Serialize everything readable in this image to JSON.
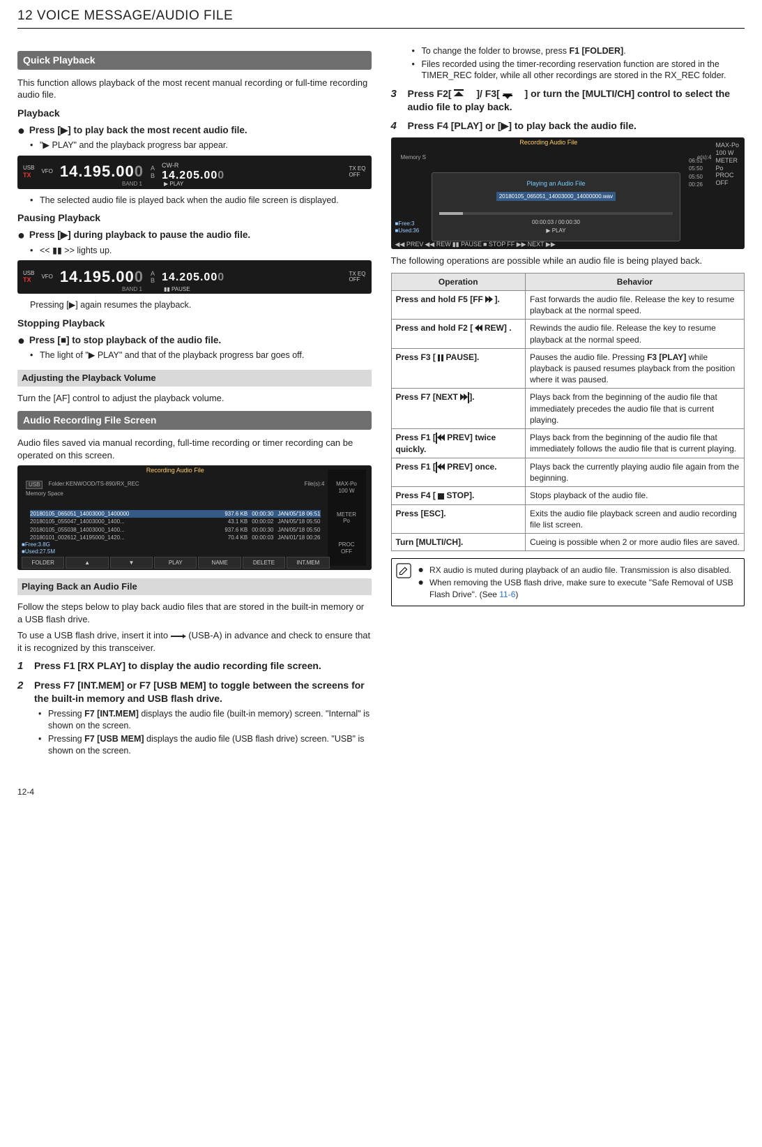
{
  "chapter": "12 VOICE MESSAGE/AUDIO FILE",
  "pageNumber": "12-4",
  "left": {
    "quickPlayback": {
      "title": "Quick Playback",
      "intro": "This function allows playback of the most recent manual recording or full-time recording audio file.",
      "playbackHeading": "Playback",
      "play_instruction": "Press [▶] to play back the most recent audio file.",
      "play_note": "\"▶ PLAY\" and the playback progress bar appear.",
      "play_note2": "The selected audio file is played back when the audio file screen is displayed.",
      "pausingHeading": "Pausing Playback",
      "pause_instruction": "Press [▶] during playback to pause the audio file.",
      "pause_note": "<< ▮▮ >> lights up.",
      "pause_resume": "Pressing [▶] again resumes the playback.",
      "stoppingHeading": "Stopping Playback",
      "stop_instruction": "Press [■] to stop playback of the audio file.",
      "stop_note": "The light of \"▶ PLAY\" and that of the playback progress bar goes off.",
      "volumeTitle": "Adjusting the Playback Volume",
      "volumeText": "Turn the [AF] control to adjust the playback volume."
    },
    "screenSmall1": {
      "usb": "USB",
      "vfo": "VFO",
      "tx": "TX",
      "freqA": "14.195.00",
      "freqA_dim": "0",
      "ab": "A▸\nB",
      "mode": "CW-R",
      "freqB": "14.205.00",
      "freqB_dim": "0",
      "band": "BAND 1",
      "play": "▶ PLAY",
      "right1": "OFF",
      "right2": "TX EQ\nOFF"
    },
    "screenSmall2": {
      "usb": "USB",
      "vfo": "VFO",
      "tx": "TX",
      "freqA": "14.195.00",
      "freqA_dim": "0",
      "freqB": "14.205.00",
      "freqB_dim": "0",
      "band": "BAND 1",
      "play": "▮▮ PAUSE",
      "right2": "TX EQ\nOFF"
    },
    "audioRecScreen": {
      "title": "Audio Recording File Screen",
      "intro": "Audio files saved via manual recording, full-time recording or timer recording can be operated on this screen."
    },
    "screenLarge": {
      "titlebar": "Recording Audio File",
      "memUSB": "USB",
      "folder": "Folder:KENWOOD/TS-890/RX_REC",
      "files": "File(s):4",
      "rows": [
        {
          "name": "20180105_065051_14003000_1400000",
          "size": "937.6 KB",
          "dur": "00:00:30",
          "date": "JAN/05/'18 06:51"
        },
        {
          "name": "20180105_055047_14003000_1400...",
          "size": "43.1 KB",
          "dur": "00:00:02",
          "date": "JAN/05/'18 05:50"
        },
        {
          "name": "20180105_055038_14003000_1400...",
          "size": "937.6 KB",
          "dur": "00:00:30",
          "date": "JAN/05/'18 05:50"
        },
        {
          "name": "20180101_002612_14195000_1420...",
          "size": "70.4 KB",
          "dur": "00:00:03",
          "date": "JAN/01/'18 00:26"
        }
      ],
      "memspace": "Memory Space",
      "free": "Free:3.8G",
      "used": "Used:27.5M",
      "buttons": [
        "FOLDER",
        "▲",
        "▼",
        "PLAY",
        "NAME",
        "DELETE",
        "INT.MEM"
      ],
      "right": [
        "MAX-Po\n100 W",
        "METER\nPo",
        "PROC\nOFF"
      ]
    },
    "playingBack": {
      "title": "Playing Back an Audio File",
      "intro1": "Follow the steps below to play back audio files that are stored in the built-in memory or a USB flash drive.",
      "intro2a": "To use a USB flash drive, insert it into ",
      "intro2b": " (USB-A) in advance and check to ensure that it is recognized by this transceiver.",
      "step1": "Press F1 [RX PLAY] to display the audio recording file screen.",
      "step2": "Press F7 [INT.MEM] or F7 [USB MEM] to toggle between the screens for the built-in memory and USB flash drive.",
      "step2_b1a": "Pressing ",
      "step2_b1b": "F7 [INT.MEM]",
      "step2_b1c": " displays the audio file (built-in memory) screen. \"Internal\" is shown on the screen.",
      "step2_b2a": "Pressing ",
      "step2_b2b": "F7 [USB MEM]",
      "step2_b2c": " displays the audio file (USB flash drive) screen. \"USB\" is shown on the screen."
    }
  },
  "right": {
    "topBullets": {
      "b1a": "To change the folder to browse, press ",
      "b1b": "F1 [FOLDER]",
      "b1c": ".",
      "b2": "Files recorded using the timer-recording reservation function are stored in the TIMER_REC folder, while all other recordings are stored in the RX_REC folder."
    },
    "step3": "Press F2[ ▲ ]/ F3[ ▼ ] or turn the [MULTI/CH] control to select the audio file to play back.",
    "step4": "Press F4 [PLAY] or [▶] to play back the audio file.",
    "screenPlay": {
      "titlebar": "Recording Audio File",
      "dlgHeader": "Playing an Audio File",
      "filename": "20180105_065051_14003000_14000000.wav",
      "time": "00:00:03 / 00:00:30",
      "play": "▶ PLAY",
      "memspace": "Memory S",
      "files": "e(s):4",
      "sideDurs": [
        "06:51",
        "05:50",
        "05:50",
        "00:26"
      ],
      "free": "Free:3",
      "used": "Used:36",
      "buttons": [
        "◀◀ PREV",
        "◀◀ REW",
        "▮▮ PAUSE",
        "■ STOP",
        "FF ▶▶",
        "NEXT ▶▶"
      ],
      "right": [
        "MAX-Po\n100 W",
        "METER\nPo",
        "PROC\nOFF"
      ]
    },
    "tableIntro": "The following operations are possible while an audio file is being played back.",
    "table": {
      "headers": [
        "Operation",
        "Behavior"
      ],
      "rows": [
        {
          "op": "Press and hold F5 [FF ▶▶ ].",
          "be": "Fast forwards the audio file. Release the key to resume playback at the normal speed."
        },
        {
          "op": "Press and hold F2 [ ◀◀ REW] .",
          "be": "Rewinds the audio file. Release the key to resume playback at the normal speed."
        },
        {
          "op": "Press F3 [ ▮▮ PAUSE].",
          "be": "Pauses the audio file. Pressing F3 [PLAY] while playback is paused resumes playback from the position where it was paused.",
          "bold": "F3 [PLAY]"
        },
        {
          "op": "Press F7 [NEXT ▶▶|].",
          "be": "Plays back from the beginning of the audio file that immediately precedes the audio file that is current playing."
        },
        {
          "op": "Press F1 [|◀◀ PREV] twice quickly.",
          "be": "Plays back from the beginning of the audio file that immediately follows the audio file that is current playing."
        },
        {
          "op": "Press F1 [|◀◀ PREV] once.",
          "be": "Plays back the currently playing audio file again from the beginning."
        },
        {
          "op": "Press F4 [ ■ STOP].",
          "be": "Stops playback of the audio file."
        },
        {
          "op": "Press [ESC].",
          "be": "Exits the audio file playback screen and audio recording file list screen."
        },
        {
          "op": "Turn [MULTI/CH].",
          "be": "Cueing is possible when 2 or more audio files are saved."
        }
      ]
    },
    "note": {
      "b1": "RX audio is muted during playback of an audio file. Transmission is also disabled.",
      "b2a": "When removing the USB flash drive, make sure to execute \"Safe Removal of USB Flash Drive\". (See ",
      "b2b": "11-6",
      "b2c": ")"
    }
  }
}
